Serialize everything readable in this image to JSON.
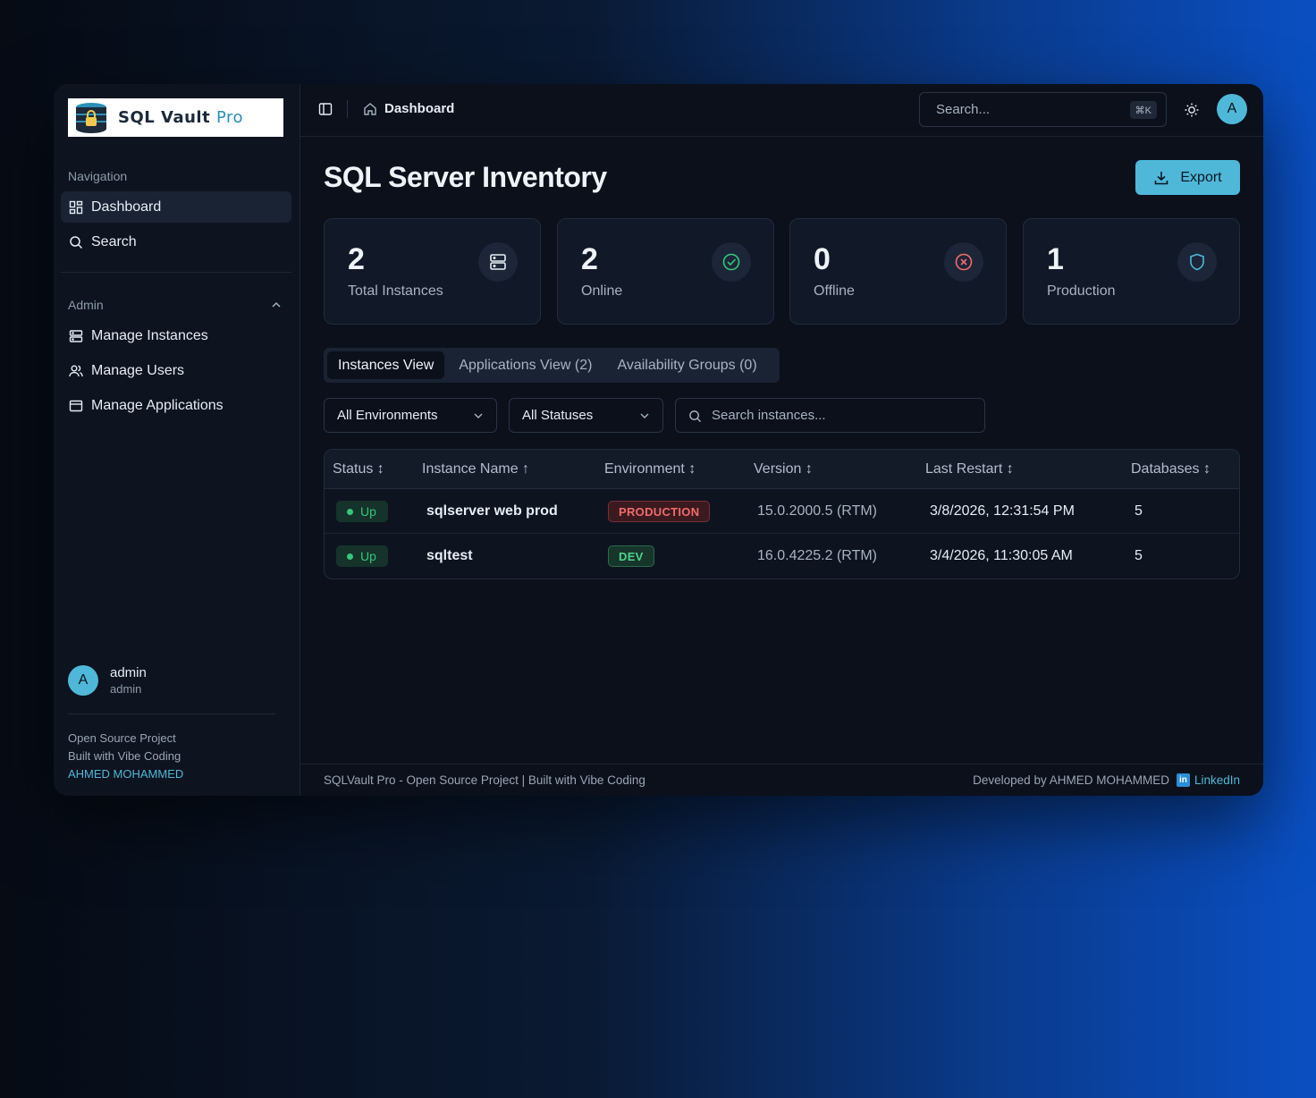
{
  "brand": {
    "name": "SQL Vault",
    "suffix": "Pro"
  },
  "sidebar": {
    "nav_label": "Navigation",
    "nav_items": [
      {
        "label": "Dashboard",
        "icon": "dashboard-icon",
        "active": true
      },
      {
        "label": "Search",
        "icon": "search-icon"
      }
    ],
    "admin_label": "Admin",
    "admin_items": [
      {
        "label": "Manage Instances",
        "icon": "server-icon"
      },
      {
        "label": "Manage Users",
        "icon": "users-icon"
      },
      {
        "label": "Manage Applications",
        "icon": "applications-icon"
      }
    ],
    "user": {
      "initial": "A",
      "name": "admin",
      "role": "admin"
    },
    "footer": {
      "line1": "Open Source Project",
      "line2": "Built with Vibe Coding",
      "author": "AHMED MOHAMMED"
    }
  },
  "topbar": {
    "breadcrumb": "Dashboard",
    "search_placeholder": "Search...",
    "shortcut": "⌘K",
    "avatar_initial": "A"
  },
  "page": {
    "title": "SQL Server Inventory",
    "export_label": "Export"
  },
  "stats": [
    {
      "value": "2",
      "label": "Total Instances",
      "icon": "server-icon"
    },
    {
      "value": "2",
      "label": "Online",
      "icon": "check-circle-icon"
    },
    {
      "value": "0",
      "label": "Offline",
      "icon": "x-circle-icon"
    },
    {
      "value": "1",
      "label": "Production",
      "icon": "shield-icon"
    }
  ],
  "tabs": [
    "Instances View",
    "Applications View (2)",
    "Availability Groups (0)"
  ],
  "filters": {
    "environment": "All Environments",
    "status": "All Statuses",
    "search_placeholder": "Search instances..."
  },
  "table": {
    "headers": [
      "Status ↕",
      "Instance Name ↑",
      "Environment ↕",
      "Version ↕",
      "Last Restart ↕",
      "Databases ↕"
    ],
    "rows": [
      {
        "status": "Up",
        "name": "sqlserver web prod",
        "environment": "PRODUCTION",
        "version": "15.0.2000.5 (RTM)",
        "last_restart": "3/8/2026, 12:31:54 PM",
        "databases": "5"
      },
      {
        "status": "Up",
        "name": "sqltest",
        "environment": "DEV",
        "version": "16.0.4225.2 (RTM)",
        "last_restart": "3/4/2026, 11:30:05 AM",
        "databases": "5"
      }
    ]
  },
  "footer": {
    "left": "SQLVault Pro - Open Source Project | Built with Vibe Coding",
    "right": "Developed by AHMED MOHAMMED",
    "link": "LinkedIn"
  },
  "colors": {
    "accent": "#4fb8d8",
    "up": "#34c77b",
    "production": "#f26b6b",
    "dev": "#4fd18c"
  }
}
